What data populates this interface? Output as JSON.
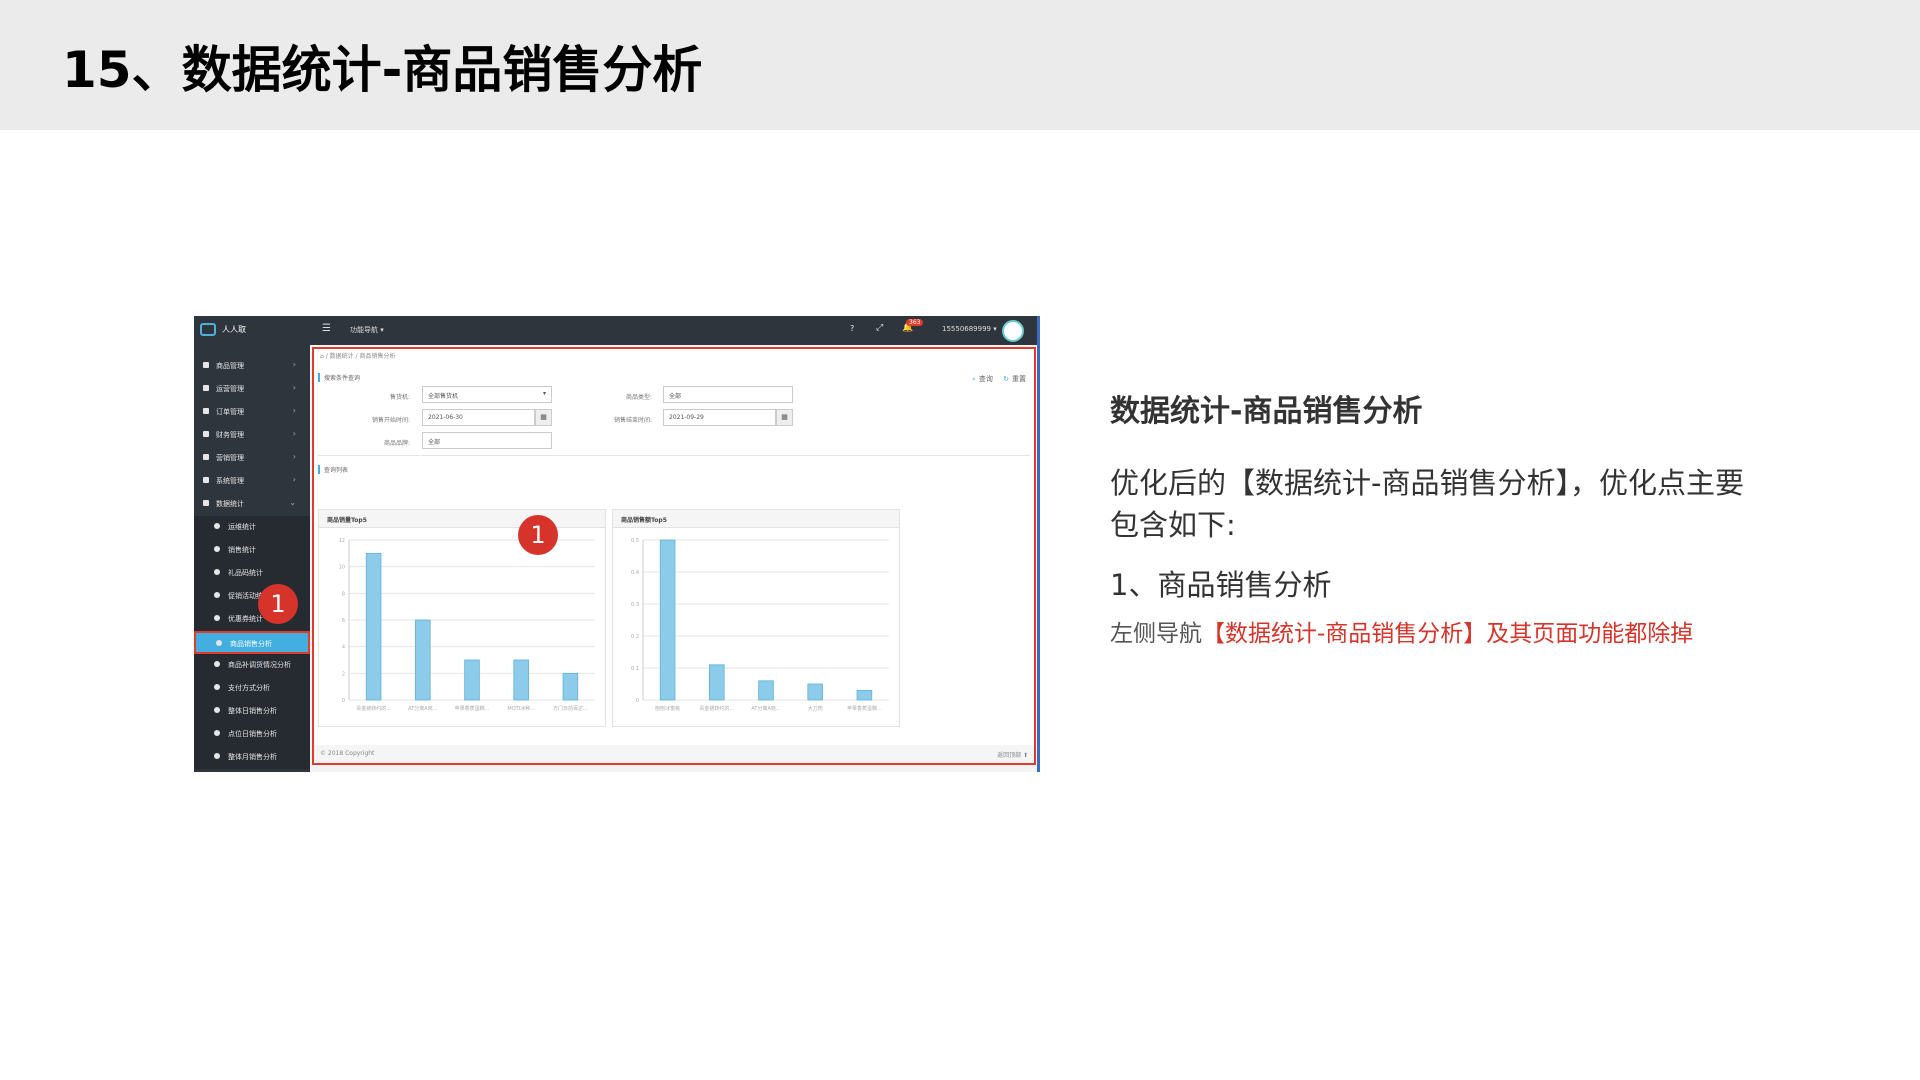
{
  "slide": {
    "title": "15、数据统计-商品销售分析"
  },
  "screenshot": {
    "topbar": {
      "brand": "人人取",
      "nav_menu": "功能导航 ▾",
      "help": "?",
      "expand": "⤢",
      "bell": "🔔",
      "badge": "363",
      "user": "15550689999 ▾"
    },
    "sidebar": {
      "items": [
        {
          "label": "商品管理",
          "arrow": "›"
        },
        {
          "label": "运营管理",
          "arrow": "›"
        },
        {
          "label": "订单管理",
          "arrow": "›"
        },
        {
          "label": "财务管理",
          "arrow": "›"
        },
        {
          "label": "营销管理",
          "arrow": "›"
        },
        {
          "label": "系统管理",
          "arrow": "›"
        },
        {
          "label": "数据统计",
          "arrow": "⌄"
        }
      ],
      "sub_items": [
        {
          "label": "运维统计"
        },
        {
          "label": "销售统计"
        },
        {
          "label": "礼品码统计"
        },
        {
          "label": "促销活动统计"
        },
        {
          "label": "优惠券统计"
        },
        {
          "label": "商品销售分析",
          "active": true
        },
        {
          "label": "商品补调货情况分析"
        },
        {
          "label": "支付方式分析"
        },
        {
          "label": "整体日销售分析"
        },
        {
          "label": "点位日销售分析"
        },
        {
          "label": "整体月销售分析"
        }
      ],
      "marker": "1"
    },
    "content": {
      "breadcrumb": "⌂  /  数据统计  /  商品销售分析",
      "search_title": "搜索条件查询",
      "actions": {
        "search_icon": "⌕",
        "search": "查询",
        "reset_icon": "↻",
        "reset": "重置"
      },
      "filters": {
        "machine_label": "售货机:",
        "machine_value": "全部售货机",
        "type_label": "商品类型:",
        "type_value": "全部",
        "start_label": "销售开始时间:",
        "start_value": "2021-06-30",
        "end_label": "销售结束时间:",
        "end_value": "2021-09-29",
        "brand_label": "商品品牌:",
        "brand_value": "全部",
        "calendar_icon": "▦"
      },
      "list_title": "查询列表",
      "panel1_title": "商品销量Top5",
      "panel2_title": "商品销售额Top5",
      "marker": "1",
      "footer_left": "© 2018 Copyright",
      "footer_right": "返回顶部 ⬆"
    }
  },
  "chart_data": [
    {
      "type": "bar",
      "title": "商品销量Top5",
      "categories": [
        "青金链转约的...",
        "AT分离A晓...",
        "苹果香蕉蛋糕...",
        "MOTI冰种...",
        "方门日前百达..."
      ],
      "values": [
        11,
        6,
        3,
        3,
        2
      ],
      "ylim": [
        0,
        12
      ],
      "yticks": [
        0,
        2,
        4,
        6,
        8,
        10,
        12
      ],
      "color": "#8ccbea"
    },
    {
      "type": "bar",
      "title": "商品销售额Top5",
      "categories": [
        "刨刨冰蜜桃",
        "青金链转约的...",
        "AT分离A晓...",
        "大刀肉",
        "苹果香蕉蛋糕..."
      ],
      "values": [
        0.5,
        0.11,
        0.06,
        0.05,
        0.03
      ],
      "ylim": [
        0,
        0.5
      ],
      "yticks": [
        0,
        0.1,
        0.2,
        0.3,
        0.4,
        0.5
      ],
      "color": "#8ccbea"
    }
  ],
  "notes": {
    "heading": "数据统计-商品销售分析",
    "paragraph": "优化后的【数据统计-商品销售分析】，优化点主要包含如下:",
    "point": "1、商品销售分析",
    "note_prefix": "左侧导航",
    "note_highlight": "【数据统计-商品销售分析】及其页面功能都除掉"
  }
}
